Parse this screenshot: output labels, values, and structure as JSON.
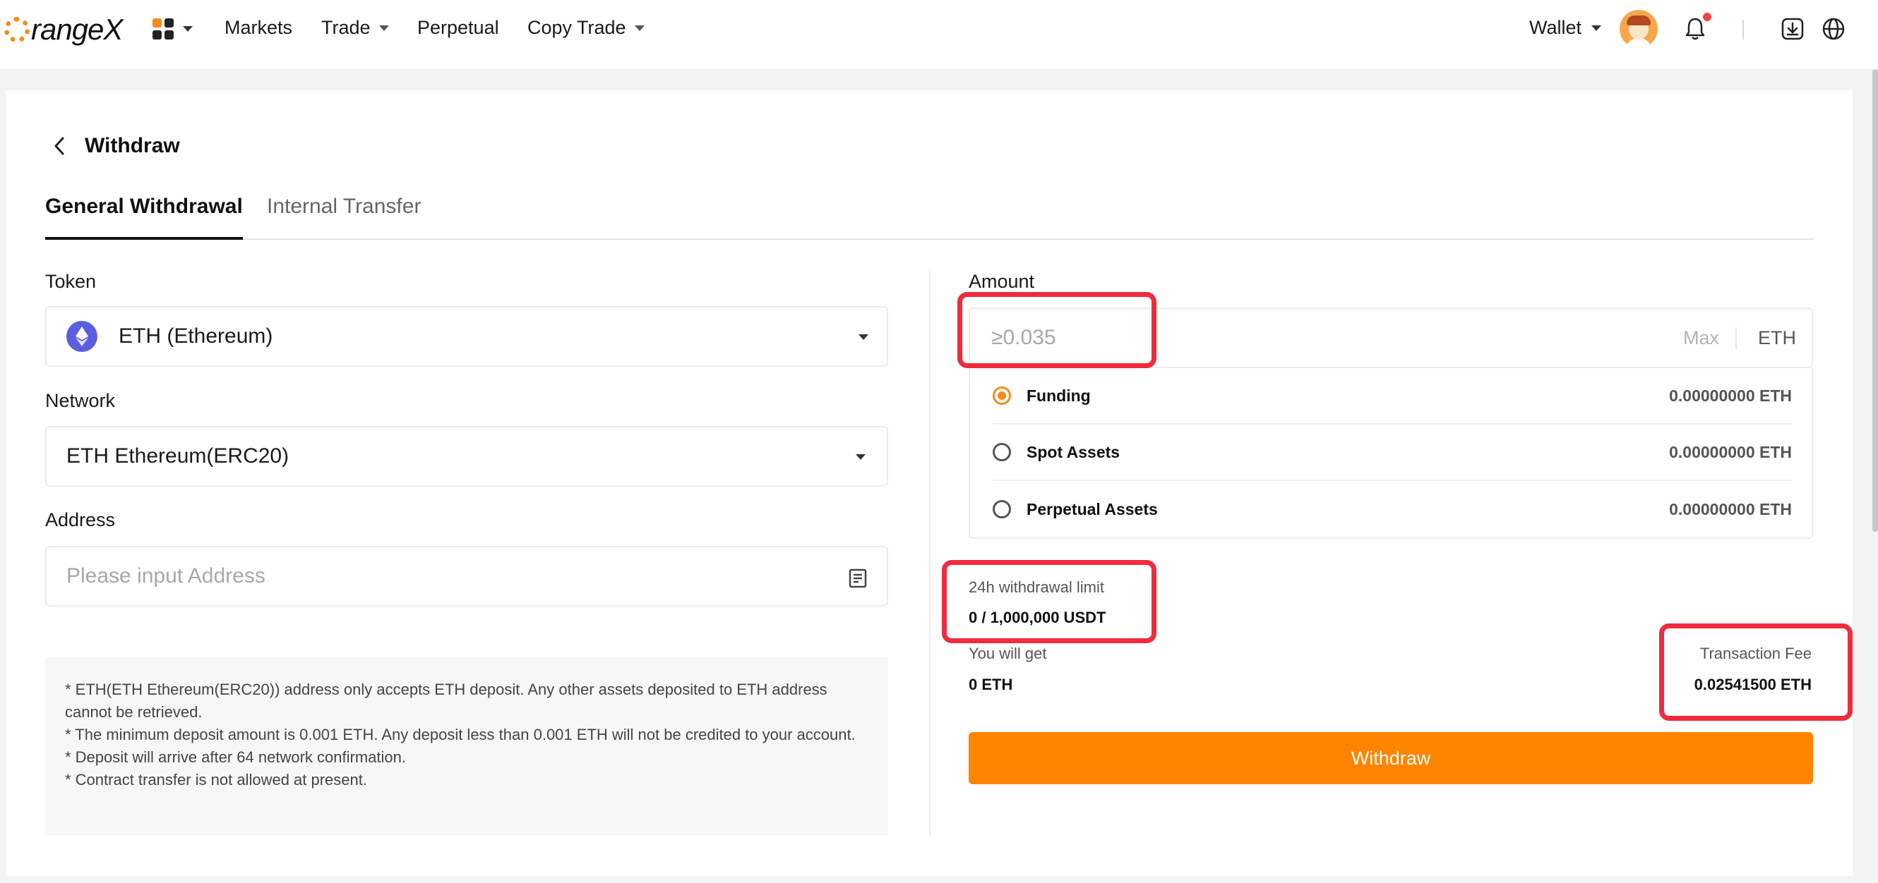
{
  "brand": {
    "logo_text": "rangeX",
    "accent_color": "#f78b1a"
  },
  "nav": {
    "items": [
      {
        "label": "Markets",
        "has_dropdown": false
      },
      {
        "label": "Trade",
        "has_dropdown": true
      },
      {
        "label": "Perpetual",
        "has_dropdown": false
      },
      {
        "label": "Copy Trade",
        "has_dropdown": true
      }
    ],
    "wallet_label": "Wallet",
    "icons": [
      "apps-grid-icon",
      "avatar",
      "bell-icon",
      "download-icon",
      "globe-icon"
    ]
  },
  "page": {
    "title": "Withdraw",
    "tabs": [
      {
        "label": "General Withdrawal",
        "active": true
      },
      {
        "label": "Internal Transfer",
        "active": false
      }
    ]
  },
  "form": {
    "token": {
      "label": "Token",
      "value": "ETH (Ethereum)"
    },
    "network": {
      "label": "Network",
      "value": "ETH Ethereum(ERC20)"
    },
    "address": {
      "label": "Address",
      "placeholder": "Please input Address"
    },
    "notes": [
      "* ETH(ETH Ethereum(ERC20)) address only accepts ETH deposit. Any other assets deposited to ETH address cannot be retrieved.",
      "* The minimum deposit amount is 0.001 ETH. Any deposit less than 0.001 ETH will not be credited to your account.",
      "* Deposit will arrive after 64 network confirmation.",
      "* Contract transfer is not allowed at present."
    ]
  },
  "amount": {
    "label": "Amount",
    "placeholder": "≥0.035",
    "max_label": "Max",
    "unit": "ETH",
    "sources": [
      {
        "name": "Funding",
        "value": "0.00000000 ETH",
        "selected": true
      },
      {
        "name": "Spot Assets",
        "value": "0.00000000 ETH",
        "selected": false
      },
      {
        "name": "Perpetual Assets",
        "value": "0.00000000 ETH",
        "selected": false
      }
    ],
    "limit_label": "24h withdrawal limit",
    "limit_value": "0 / 1,000,000 USDT",
    "get_label": "You will get",
    "get_value": "0 ETH",
    "fee_label": "Transaction Fee",
    "fee_value": "0.02541500 ETH",
    "submit_label": "Withdraw"
  },
  "colors": {
    "button": "#ff8400",
    "highlight": "#ef2b3e",
    "eth": "#5a5fe0"
  }
}
